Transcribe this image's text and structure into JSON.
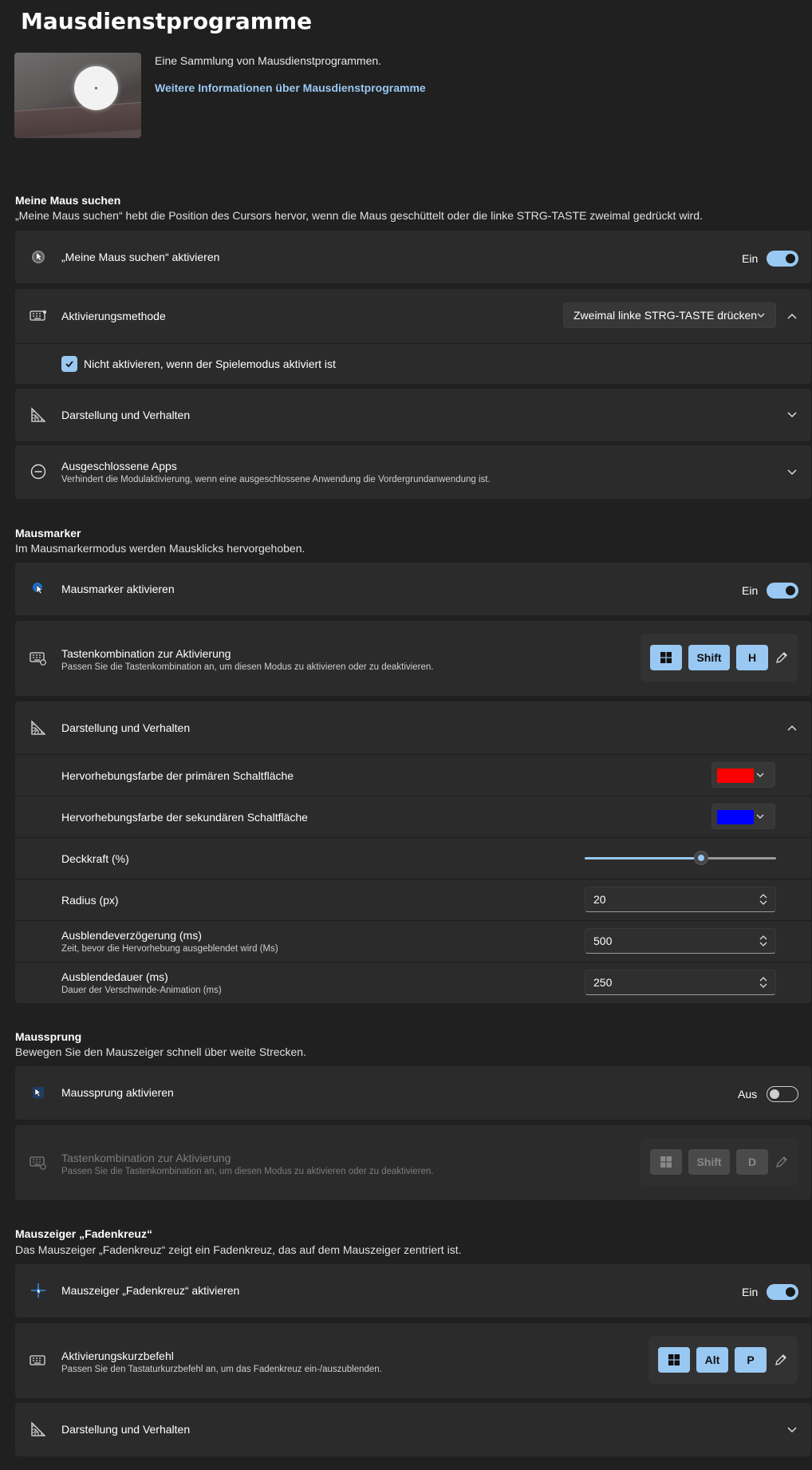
{
  "page": {
    "title": "Mausdienstprogramme"
  },
  "hero": {
    "description": "Eine Sammlung von Mausdienstprogrammen.",
    "link": "Weitere Informationen über Mausdienstprogramme"
  },
  "find_mouse": {
    "title": "Meine Maus suchen",
    "description": "„Meine Maus suchen“ hebt die Position des Cursors hervor, wenn die Maus geschüttelt oder die linke STRG-TASTE zweimal gedrückt wird.",
    "enable_label": "„Meine Maus suchen“ aktivieren",
    "enable_state": "Ein",
    "activation_label": "Aktivierungsmethode",
    "activation_value": "Zweimal linke STRG-TASTE drücken",
    "gamemode_label": "Nicht aktivieren, wenn der Spielemodus aktiviert ist",
    "appearance_label": "Darstellung und Verhalten",
    "excluded_label": "Ausgeschlossene Apps",
    "excluded_sub": "Verhindert die Modulaktivierung, wenn eine ausgeschlossene Anwendung die Vordergrundanwendung ist."
  },
  "highlighter": {
    "title": "Mausmarker",
    "description": "Im Mausmarkermodus werden Mausklicks hervorgehoben.",
    "enable_label": "Mausmarker aktivieren",
    "enable_state": "Ein",
    "shortcut_label": "Tastenkombination zur Aktivierung",
    "shortcut_sub": "Passen Sie die Tastenkombination an, um diesen Modus zu aktivieren oder zu deaktivieren.",
    "keys": [
      "Shift",
      "H"
    ],
    "appearance_label": "Darstellung und Verhalten",
    "primary_color_label": "Hervorhebungsfarbe der primären Schaltfläche",
    "primary_color": "#ff0000",
    "secondary_color_label": "Hervorhebungsfarbe der sekundären Schaltfläche",
    "secondary_color": "#0000ff",
    "opacity_label": "Deckkraft (%)",
    "opacity_fraction": 0.61,
    "radius_label": "Radius (px)",
    "radius_value": "20",
    "fade_delay_label": "Ausblendeverzögerung (ms)",
    "fade_delay_sub": "Zeit, bevor die Hervorhebung ausgeblendet wird (Ms)",
    "fade_delay_value": "500",
    "fade_duration_label": "Ausblendedauer (ms)",
    "fade_duration_sub": "Dauer der Verschwinde-Animation (ms)",
    "fade_duration_value": "250"
  },
  "jump": {
    "title": "Maussprung",
    "description": "Bewegen Sie den Mauszeiger schnell über weite Strecken.",
    "enable_label": "Maussprung aktivieren",
    "enable_state": "Aus",
    "shortcut_label": "Tastenkombination zur Aktivierung",
    "shortcut_sub": "Passen Sie die Tastenkombination an, um diesen Modus zu aktivieren oder zu deaktivieren.",
    "keys": [
      "Shift",
      "D"
    ]
  },
  "crosshairs": {
    "title": "Mauszeiger „Fadenkreuz“",
    "description": "Das Mauszeiger „Fadenkreuz“ zeigt ein Fadenkreuz, das auf dem Mauszeiger zentriert ist.",
    "enable_label": "Mauszeiger „Fadenkreuz“ aktivieren",
    "enable_state": "Ein",
    "shortcut_label": "Aktivierungskurzbefehl",
    "shortcut_sub": "Passen Sie den Tastaturkurzbefehl an, um das Fadenkreuz ein-/auszublenden.",
    "keys": [
      "Alt",
      "P"
    ],
    "appearance_label": "Darstellung und Verhalten"
  },
  "colors": {
    "accent": "#99c8f2",
    "background": "#202020",
    "card": "#2b2b2b"
  }
}
